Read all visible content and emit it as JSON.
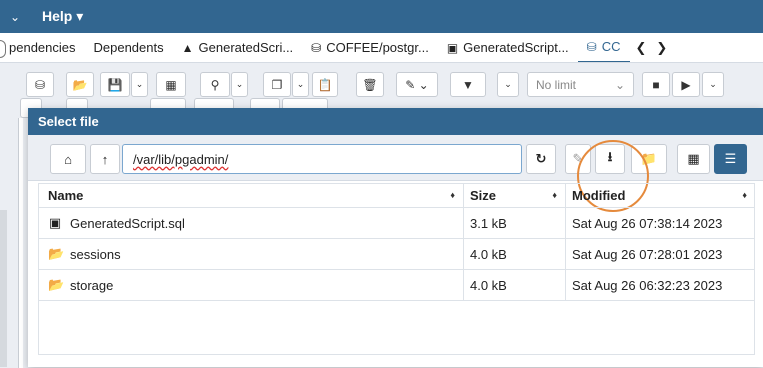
{
  "menubar": {
    "chevron_icon": "chevron-down-icon",
    "help_label": "Help ▾"
  },
  "tabs": [
    {
      "label": "pendencies",
      "icon": ""
    },
    {
      "label": "Dependents",
      "icon": ""
    },
    {
      "label": "GeneratedScri...",
      "icon": "sitemap-icon"
    },
    {
      "label": "COFFEE/postgr...",
      "icon": "database-icon"
    },
    {
      "label": "GeneratedScript...",
      "icon": "file-icon"
    },
    {
      "label": "CC",
      "icon": "database-icon"
    }
  ],
  "toolbar": {
    "no_limit_label": "No limit"
  },
  "dialog": {
    "title": "Select file",
    "path_value": "/var/lib/pgadmin/",
    "columns": {
      "name": "Name",
      "size": "Size",
      "modified": "Modified"
    },
    "rows": [
      {
        "name": "GeneratedScript.sql",
        "type": "file",
        "size": "3.1 kB",
        "modified": "Sat Aug 26 07:38:14 2023"
      },
      {
        "name": "sessions",
        "type": "folder",
        "size": "4.0 kB",
        "modified": "Sat Aug 26 07:28:01 2023"
      },
      {
        "name": "storage",
        "type": "folder",
        "size": "4.0 kB",
        "modified": "Sat Aug 26 06:32:23 2023"
      }
    ]
  },
  "colors": {
    "brand": "#326690",
    "highlight_ring": "#e58a3c",
    "background": "#ebeef3"
  }
}
